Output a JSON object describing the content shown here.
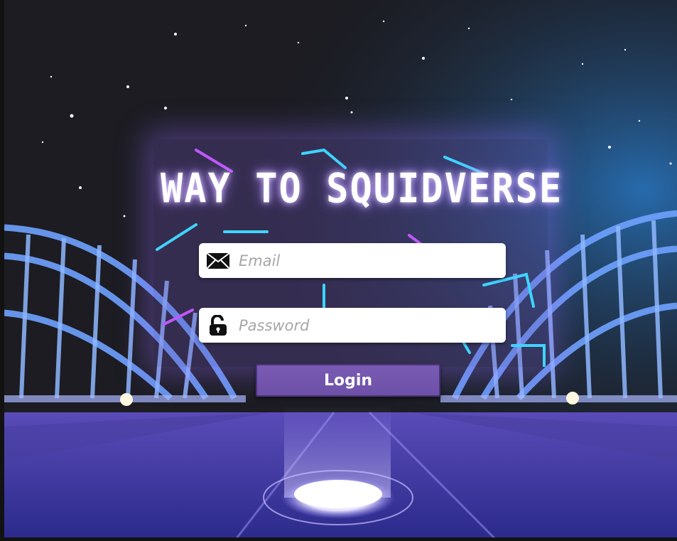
{
  "app": {
    "title": "WAY TO SQUIDVERSE"
  },
  "form": {
    "email_placeholder": "Email",
    "email_value": "",
    "password_placeholder": "Password",
    "password_value": "",
    "login_label": "Login"
  },
  "icons": {
    "email": "envelope-icon",
    "password": "unlock-icon"
  },
  "colors": {
    "accent": "#6d50a8",
    "glow": "#a57dff",
    "sky": "#1c1c22",
    "bridge": "#3a6ed8"
  }
}
